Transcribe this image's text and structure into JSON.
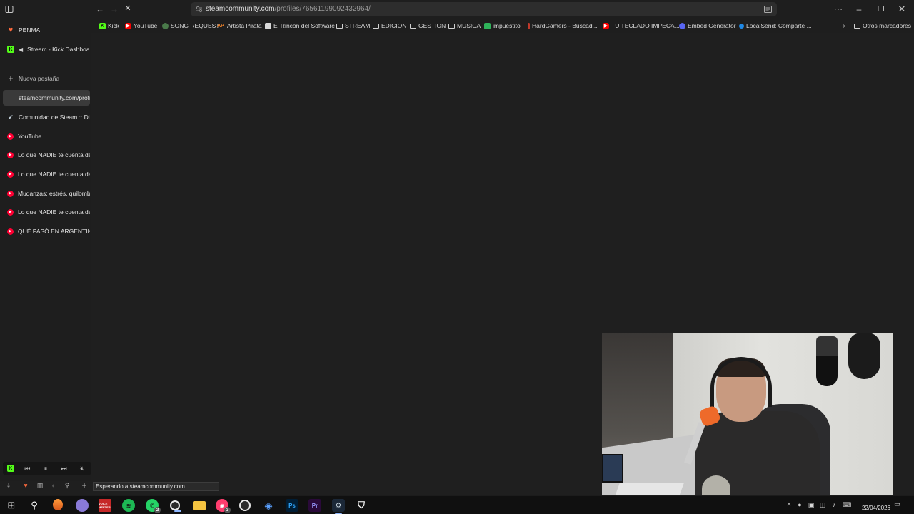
{
  "browser": {
    "url_host": "steamcommunity.com",
    "url_path": "/profiles/76561199092432964/",
    "status_text": "Esperando a steamcommunity.com..."
  },
  "bookmarks": [
    {
      "label": "Kick",
      "icon": "kick-icon",
      "badge": "K"
    },
    {
      "label": "YouTube",
      "icon": "youtube-icon",
      "badge": "▶"
    },
    {
      "label": "SONG REQUEST",
      "icon": "song-request-icon",
      "badge": ""
    },
    {
      "label": "Artista Pirata",
      "icon": "artista-pirata-icon",
      "badge": "AP"
    },
    {
      "label": "El Rincon del Software",
      "icon": "rincon-icon",
      "badge": ""
    },
    {
      "label": "STREAM",
      "icon": "folder-icon",
      "badge": ""
    },
    {
      "label": "EDICION",
      "icon": "folder-icon",
      "badge": ""
    },
    {
      "label": "GESTION",
      "icon": "folder-icon",
      "badge": ""
    },
    {
      "label": "MUSICA",
      "icon": "folder-icon",
      "badge": ""
    },
    {
      "label": "impuestito",
      "icon": "impuestito-icon",
      "badge": ""
    },
    {
      "label": "HardGamers - Buscad...",
      "icon": "hardgamers-icon",
      "badge": ""
    },
    {
      "label": "TU TECLADO IMPECA...",
      "icon": "youtube-icon",
      "badge": "▶"
    },
    {
      "label": "Embed Generator",
      "icon": "embed-generator-icon",
      "badge": ""
    },
    {
      "label": "LocalSend: Comparte ...",
      "icon": "localsend-icon",
      "badge": ""
    }
  ],
  "other_bookmarks": "Otros marcadores",
  "sidebar": {
    "pinned": [
      {
        "label": "PENMA",
        "icon": "heart-icon"
      },
      {
        "label": "Stream - Kick Dashboard",
        "icon": "kick-icon"
      }
    ],
    "new_tab": "Nueva pestaña",
    "tabs": [
      {
        "label": "steamcommunity.com/profiles/",
        "icon": "blank-icon"
      },
      {
        "label": "Comunidad de Steam :: Di",
        "icon": "steam-icon"
      },
      {
        "label": "YouTube",
        "icon": "youtube-icon"
      },
      {
        "label": "Lo que NADIE te cuenta de",
        "icon": "youtube-icon"
      },
      {
        "label": "Lo que NADIE te cuenta de",
        "icon": "youtube-icon"
      },
      {
        "label": "Mudanzas: estrés, quilombo",
        "icon": "youtube-icon"
      },
      {
        "label": "Lo que NADIE te cuenta de",
        "icon": "youtube-icon"
      },
      {
        "label": "QUÉ PASÓ EN ARGENTINA",
        "icon": "youtube-icon"
      }
    ]
  },
  "taskbar": {
    "whatsapp_badge": "2",
    "discord_badge": "3",
    "voicemeeter_label": "VOICE MEETER",
    "clock": "22/04/2026"
  },
  "colors": {
    "background": "#1f1f1f",
    "accent_kick": "#53fc18",
    "accent_youtube": "#ff0033",
    "accent_heart": "#ff6a3d"
  }
}
